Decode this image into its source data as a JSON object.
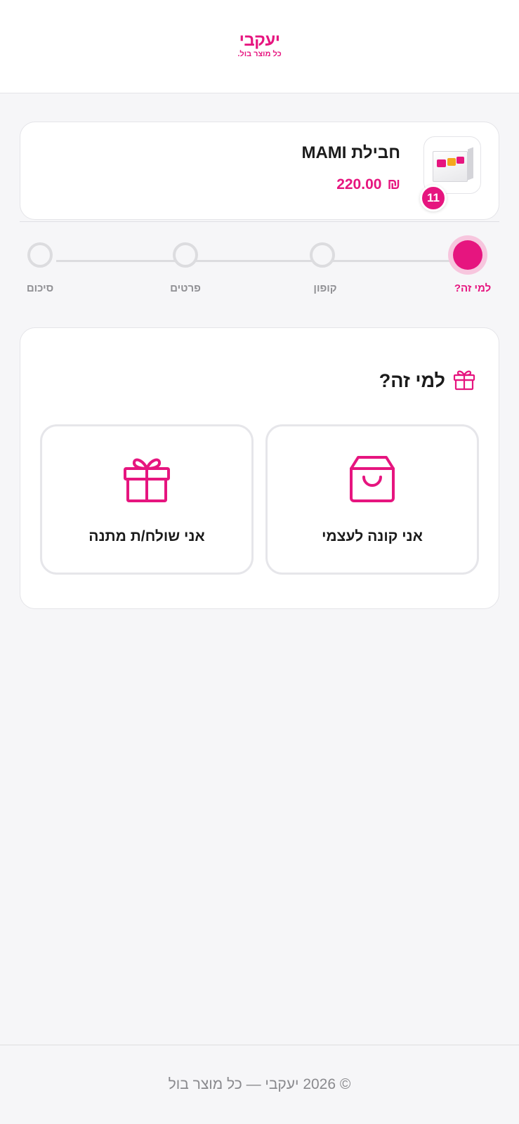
{
  "brand": {
    "name": "יעקבי",
    "tagline": "כל מוצר בול.",
    "accent_color": "#e6157f"
  },
  "product": {
    "title": "חבילת MAMI",
    "price": "220.00",
    "currency": "₪",
    "quantity": "11",
    "image_icon": "product-box-image"
  },
  "steps": [
    {
      "label": "למי זה?",
      "active": true
    },
    {
      "label": "קופון",
      "active": false
    },
    {
      "label": "פרטים",
      "active": false
    },
    {
      "label": "סיכום",
      "active": false
    }
  ],
  "choice": {
    "heading": "למי זה?",
    "heading_icon": "gift-icon",
    "options": [
      {
        "label": "אני קונה לעצמי",
        "icon": "shopping-bag-icon"
      },
      {
        "label": "אני שולח/ת מתנה",
        "icon": "gift-icon"
      }
    ]
  },
  "footer": {
    "text": "© 2026 יעקבי — כל מוצר בול"
  }
}
